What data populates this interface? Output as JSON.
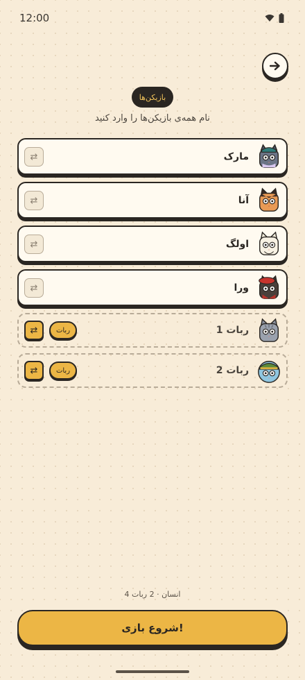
{
  "status_bar": {
    "time": "12:00"
  },
  "header": {
    "badge": "بازیکن‌ها",
    "subtitle": "نام همه‌ی بازیکن‌ها را وارد کنید"
  },
  "players": [
    {
      "name": "مارک",
      "type": "human",
      "avatar": "cat-teal-cap",
      "swap_icon": "⇄"
    },
    {
      "name": "آنا",
      "type": "human",
      "avatar": "cat-orange",
      "swap_icon": "⇄"
    },
    {
      "name": "اولگ",
      "type": "human",
      "avatar": "cat-white",
      "swap_icon": "⇄"
    },
    {
      "name": "ورا",
      "type": "human",
      "avatar": "cat-red-beret",
      "swap_icon": "⇄"
    },
    {
      "name": "ربات 1",
      "type": "bot",
      "badge": "ربات",
      "avatar": "cat-gray",
      "swap_icon": "⇄"
    },
    {
      "name": "ربات 2",
      "type": "bot",
      "badge": "ربات",
      "avatar": "cat-blue-green-hat",
      "swap_icon": "⇄"
    }
  ],
  "summary": "4 انسان · 2 ربات",
  "start_button": "شروع بازی!",
  "colors": {
    "background": "#f8ecd8",
    "accent": "#ecb645",
    "ink": "#2a2622",
    "card": "#fffaf0"
  }
}
